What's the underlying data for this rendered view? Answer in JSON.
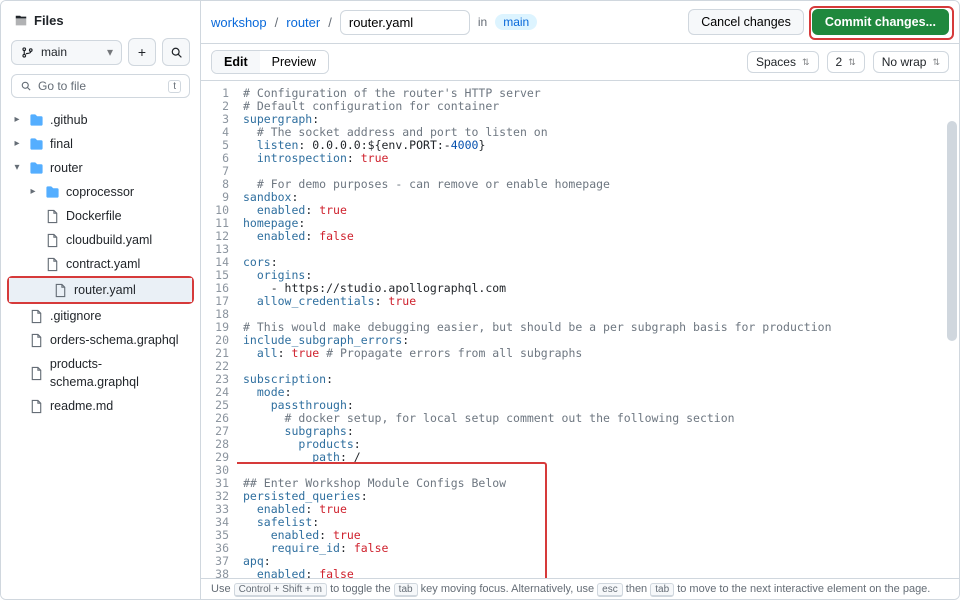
{
  "sidebar": {
    "title": "Files",
    "branch": "main",
    "goto_placeholder": "Go to file",
    "goto_key": "t",
    "tree": [
      {
        "type": "folder",
        "name": ".github",
        "expanded": false,
        "depth": 0
      },
      {
        "type": "folder",
        "name": "final",
        "expanded": false,
        "depth": 0
      },
      {
        "type": "folder",
        "name": "router",
        "expanded": true,
        "depth": 0
      },
      {
        "type": "folder",
        "name": "coprocessor",
        "expanded": false,
        "depth": 1
      },
      {
        "type": "file",
        "name": "Dockerfile",
        "depth": 1
      },
      {
        "type": "file",
        "name": "cloudbuild.yaml",
        "depth": 1
      },
      {
        "type": "file",
        "name": "contract.yaml",
        "depth": 1
      },
      {
        "type": "file",
        "name": "router.yaml",
        "depth": 1,
        "selected": true,
        "ring": true
      },
      {
        "type": "file",
        "name": ".gitignore",
        "depth": 0
      },
      {
        "type": "file",
        "name": "orders-schema.graphql",
        "depth": 0
      },
      {
        "type": "file",
        "name": "products-schema.graphql",
        "depth": 0
      },
      {
        "type": "file",
        "name": "readme.md",
        "depth": 0
      }
    ]
  },
  "breadcrumb": {
    "root": "workshop",
    "dir": "router",
    "file": "router.yaml",
    "in": "in",
    "branch": "main"
  },
  "buttons": {
    "cancel": "Cancel changes",
    "commit": "Commit changes..."
  },
  "edtabs": {
    "edit": "Edit",
    "preview": "Preview"
  },
  "edopts": {
    "indent": "Spaces",
    "size": "2",
    "wrap": "No wrap"
  },
  "code": {
    "lines": [
      {
        "n": 1,
        "seg": [
          [
            "c",
            "# Configuration of the router's HTTP server"
          ]
        ]
      },
      {
        "n": 2,
        "seg": [
          [
            "c",
            "# Default configuration for container"
          ]
        ]
      },
      {
        "n": 3,
        "seg": [
          [
            "k",
            "supergraph"
          ],
          [
            "p",
            ":"
          ]
        ]
      },
      {
        "n": 4,
        "seg": [
          [
            "p",
            "  "
          ],
          [
            "c",
            "# The socket address and port to listen on"
          ]
        ]
      },
      {
        "n": 5,
        "seg": [
          [
            "p",
            "  "
          ],
          [
            "k",
            "listen"
          ],
          [
            "p",
            ": 0.0.0.0:${env.PORT:-"
          ],
          [
            "n",
            "4000"
          ],
          [
            "p",
            "}"
          ]
        ]
      },
      {
        "n": 6,
        "seg": [
          [
            "p",
            "  "
          ],
          [
            "k",
            "introspection"
          ],
          [
            "p",
            ": "
          ],
          [
            "b",
            "true"
          ]
        ]
      },
      {
        "n": 7,
        "seg": []
      },
      {
        "n": 8,
        "seg": [
          [
            "p",
            "  "
          ],
          [
            "c",
            "# For demo purposes - can remove or enable homepage"
          ]
        ]
      },
      {
        "n": 9,
        "seg": [
          [
            "k",
            "sandbox"
          ],
          [
            "p",
            ":"
          ]
        ]
      },
      {
        "n": 10,
        "seg": [
          [
            "p",
            "  "
          ],
          [
            "k",
            "enabled"
          ],
          [
            "p",
            ": "
          ],
          [
            "b",
            "true"
          ]
        ]
      },
      {
        "n": 11,
        "seg": [
          [
            "k",
            "homepage"
          ],
          [
            "p",
            ":"
          ]
        ]
      },
      {
        "n": 12,
        "seg": [
          [
            "p",
            "  "
          ],
          [
            "k",
            "enabled"
          ],
          [
            "p",
            ": "
          ],
          [
            "b",
            "false"
          ]
        ]
      },
      {
        "n": 13,
        "seg": []
      },
      {
        "n": 14,
        "seg": [
          [
            "k",
            "cors"
          ],
          [
            "p",
            ":"
          ]
        ]
      },
      {
        "n": 15,
        "seg": [
          [
            "p",
            "  "
          ],
          [
            "k",
            "origins"
          ],
          [
            "p",
            ":"
          ]
        ]
      },
      {
        "n": 16,
        "seg": [
          [
            "p",
            "    - https://studio.apollographql.com"
          ]
        ]
      },
      {
        "n": 17,
        "seg": [
          [
            "p",
            "  "
          ],
          [
            "k",
            "allow_credentials"
          ],
          [
            "p",
            ": "
          ],
          [
            "b",
            "true"
          ]
        ]
      },
      {
        "n": 18,
        "seg": []
      },
      {
        "n": 19,
        "seg": [
          [
            "c",
            "# This would make debugging easier, but should be a per subgraph basis for production"
          ]
        ]
      },
      {
        "n": 20,
        "seg": [
          [
            "k",
            "include_subgraph_errors"
          ],
          [
            "p",
            ":"
          ]
        ]
      },
      {
        "n": 21,
        "seg": [
          [
            "p",
            "  "
          ],
          [
            "k",
            "all"
          ],
          [
            "p",
            ": "
          ],
          [
            "b",
            "true"
          ],
          [
            "p",
            " "
          ],
          [
            "c",
            "# Propagate errors from all subgraphs"
          ]
        ]
      },
      {
        "n": 22,
        "seg": []
      },
      {
        "n": 23,
        "seg": [
          [
            "k",
            "subscription"
          ],
          [
            "p",
            ":"
          ]
        ]
      },
      {
        "n": 24,
        "seg": [
          [
            "p",
            "  "
          ],
          [
            "k",
            "mode"
          ],
          [
            "p",
            ":"
          ]
        ]
      },
      {
        "n": 25,
        "seg": [
          [
            "p",
            "    "
          ],
          [
            "k",
            "passthrough"
          ],
          [
            "p",
            ":"
          ]
        ]
      },
      {
        "n": 26,
        "seg": [
          [
            "p",
            "      "
          ],
          [
            "c",
            "# docker setup, for local setup comment out the following section"
          ]
        ]
      },
      {
        "n": 27,
        "seg": [
          [
            "p",
            "      "
          ],
          [
            "k",
            "subgraphs"
          ],
          [
            "p",
            ":"
          ]
        ]
      },
      {
        "n": 28,
        "seg": [
          [
            "p",
            "        "
          ],
          [
            "k",
            "products"
          ],
          [
            "p",
            ":"
          ]
        ]
      },
      {
        "n": 29,
        "seg": [
          [
            "p",
            "          "
          ],
          [
            "k",
            "path"
          ],
          [
            "p",
            ": /"
          ]
        ]
      },
      {
        "n": 30,
        "seg": []
      },
      {
        "n": 31,
        "seg": [
          [
            "c",
            "## Enter Workshop Module Configs Below"
          ]
        ]
      },
      {
        "n": 32,
        "seg": [
          [
            "k",
            "persisted_queries"
          ],
          [
            "p",
            ":"
          ]
        ]
      },
      {
        "n": 33,
        "seg": [
          [
            "p",
            "  "
          ],
          [
            "k",
            "enabled"
          ],
          [
            "p",
            ": "
          ],
          [
            "b",
            "true"
          ]
        ]
      },
      {
        "n": 34,
        "seg": [
          [
            "p",
            "  "
          ],
          [
            "k",
            "safelist"
          ],
          [
            "p",
            ":"
          ]
        ]
      },
      {
        "n": 35,
        "seg": [
          [
            "p",
            "    "
          ],
          [
            "k",
            "enabled"
          ],
          [
            "p",
            ": "
          ],
          [
            "b",
            "true"
          ]
        ]
      },
      {
        "n": 36,
        "seg": [
          [
            "p",
            "    "
          ],
          [
            "k",
            "require_id"
          ],
          [
            "p",
            ": "
          ],
          [
            "b",
            "false"
          ]
        ]
      },
      {
        "n": 37,
        "seg": [
          [
            "k",
            "apq"
          ],
          [
            "p",
            ":"
          ]
        ]
      },
      {
        "n": 38,
        "seg": [
          [
            "p",
            "  "
          ],
          [
            "k",
            "enabled"
          ],
          [
            "p",
            ": "
          ],
          [
            "b",
            "false"
          ]
        ]
      }
    ]
  },
  "status": {
    "pre": "Use ",
    "k1": "Control + Shift + m",
    "mid": " to toggle the ",
    "k2": "tab",
    "mid2": " key moving focus. Alternatively, use ",
    "k3": "esc",
    "mid3": " then ",
    "k4": "tab",
    "end": " to move to the next interactive element on the page."
  }
}
